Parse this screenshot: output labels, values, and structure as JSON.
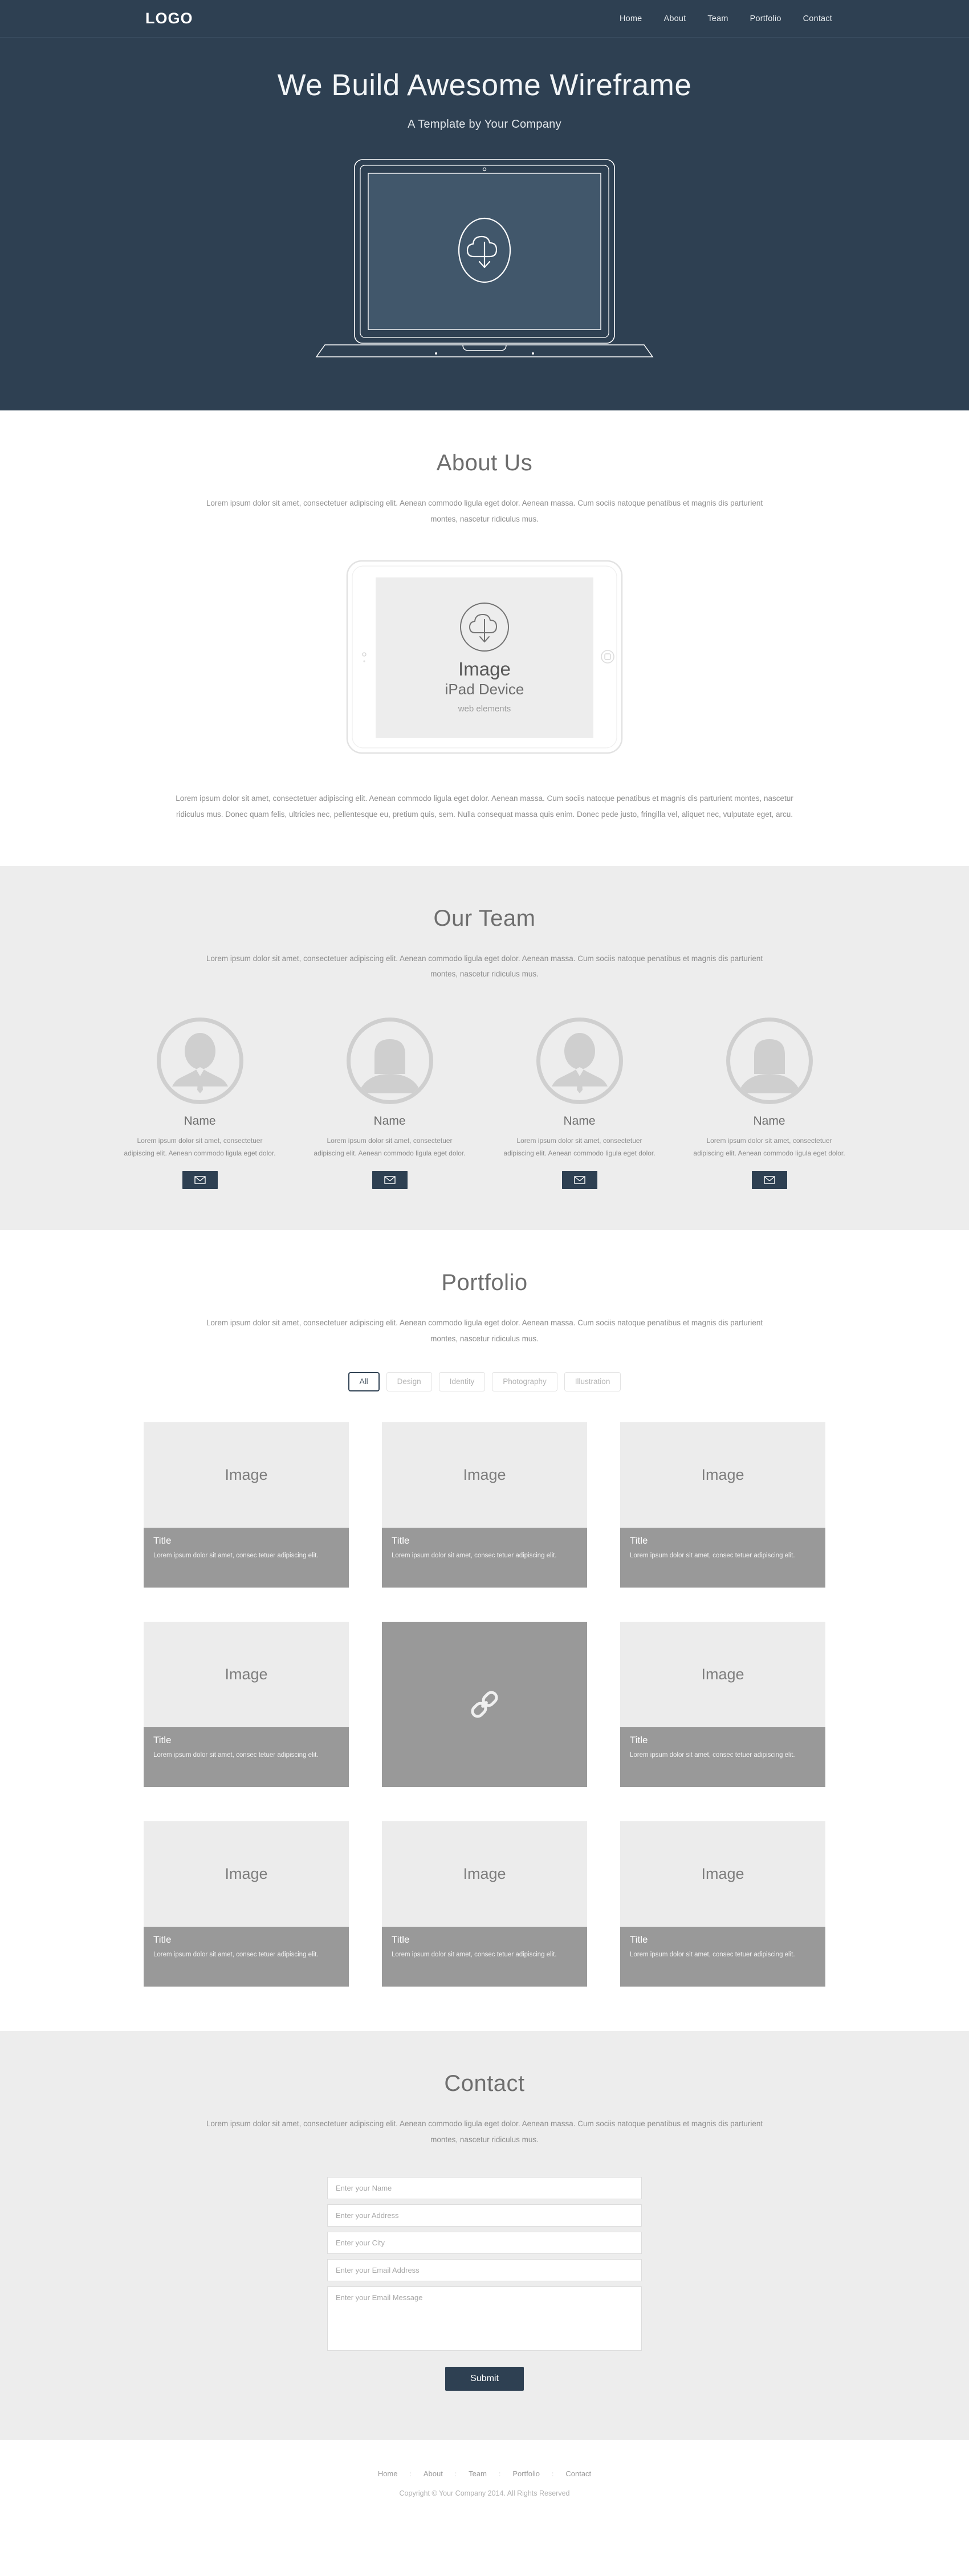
{
  "header": {
    "logo": "LOGO",
    "nav": [
      "Home",
      "About",
      "Team",
      "Portfolio",
      "Contact"
    ]
  },
  "hero": {
    "title": "We Build Awesome Wireframe",
    "subtitle": "A Template by Your Company",
    "device_icon": "cloud-download-icon"
  },
  "about": {
    "title": "About Us",
    "subtitle": "Lorem ipsum dolor sit amet, consectetuer adipiscing elit. Aenean commodo ligula eget dolor. Aenean massa. Cum sociis natoque penatibus et magnis dis parturient montes, nascetur ridiculus mus.",
    "device": {
      "image_label": "Image",
      "device_label": "iPad  Device",
      "caption": "web elements",
      "icon": "cloud-download-icon"
    },
    "body": "Lorem ipsum dolor sit amet, consectetuer adipiscing elit. Aenean commodo ligula eget dolor. Aenean massa. Cum sociis natoque penatibus et magnis dis parturient montes, nascetur ridiculus mus. Donec quam felis, ultricies nec, pellentesque eu, pretium quis, sem. Nulla consequat massa quis enim. Donec pede justo, fringilla vel, aliquet nec, vulputate eget, arcu."
  },
  "team": {
    "title": "Our Team",
    "subtitle": "Lorem ipsum dolor sit amet, consectetuer adipiscing elit. Aenean commodo ligula eget dolor. Aenean massa. Cum sociis natoque penatibus et magnis dis parturient montes, nascetur ridiculus mus.",
    "members": [
      {
        "name": "Name",
        "text": "Lorem ipsum dolor sit amet, consectetuer adipiscing elit. Aenean commodo ligula eget dolor.",
        "avatar": "avatar-male",
        "button_icon": "envelope-icon"
      },
      {
        "name": "Name",
        "text": "Lorem ipsum dolor sit amet, consectetuer adipiscing elit. Aenean commodo ligula eget dolor.",
        "avatar": "avatar-plain",
        "button_icon": "envelope-icon"
      },
      {
        "name": "Name",
        "text": "Lorem ipsum dolor sit amet, consectetuer adipiscing elit. Aenean commodo ligula eget dolor.",
        "avatar": "avatar-male",
        "button_icon": "envelope-icon"
      },
      {
        "name": "Name",
        "text": "Lorem ipsum dolor sit amet, consectetuer adipiscing elit. Aenean commodo ligula eget dolor.",
        "avatar": "avatar-plain",
        "button_icon": "envelope-icon"
      }
    ]
  },
  "portfolio": {
    "title": "Portfolio",
    "subtitle": "Lorem ipsum dolor sit amet, consectetuer adipiscing elit. Aenean commodo ligula eget dolor. Aenean massa. Cum sociis natoque penatibus et magnis dis parturient montes, nascetur ridiculus mus.",
    "filters": [
      {
        "label": "All",
        "active": true
      },
      {
        "label": "Design",
        "active": false
      },
      {
        "label": "Identity",
        "active": false
      },
      {
        "label": "Photography",
        "active": false
      },
      {
        "label": "Illustration",
        "active": false
      }
    ],
    "items": [
      {
        "image_label": "Image",
        "title": "Title",
        "desc": "Lorem ipsum dolor sit amet, consec tetuer adipiscing elit.",
        "state": "normal"
      },
      {
        "image_label": "Image",
        "title": "Title",
        "desc": "Lorem ipsum dolor sit amet, consec tetuer adipiscing elit.",
        "state": "normal"
      },
      {
        "image_label": "Image",
        "title": "Title",
        "desc": "Lorem ipsum dolor sit amet, consec tetuer adipiscing elit.",
        "state": "normal"
      },
      {
        "image_label": "Image",
        "title": "Title",
        "desc": "Lorem ipsum dolor sit amet, consec tetuer adipiscing elit.",
        "state": "normal"
      },
      {
        "image_label": "",
        "title": "",
        "desc": "",
        "state": "hovered",
        "icon": "chain-link-icon"
      },
      {
        "image_label": "Image",
        "title": "Title",
        "desc": "Lorem ipsum dolor sit amet, consec tetuer adipiscing elit.",
        "state": "normal"
      },
      {
        "image_label": "Image",
        "title": "Title",
        "desc": "Lorem ipsum dolor sit amet, consec tetuer adipiscing elit.",
        "state": "normal"
      },
      {
        "image_label": "Image",
        "title": "Title",
        "desc": "Lorem ipsum dolor sit amet, consec tetuer adipiscing elit.",
        "state": "normal"
      },
      {
        "image_label": "Image",
        "title": "Title",
        "desc": "Lorem ipsum dolor sit amet, consec tetuer adipiscing elit.",
        "state": "normal"
      }
    ]
  },
  "contact": {
    "title": "Contact",
    "subtitle": "Lorem ipsum dolor sit amet, consectetuer adipiscing elit. Aenean commodo ligula eget dolor. Aenean massa. Cum sociis natoque penatibus et magnis dis parturient montes, nascetur ridiculus mus.",
    "fields": {
      "name": {
        "placeholder": "Enter your Name",
        "value": ""
      },
      "address": {
        "placeholder": "Enter your Address",
        "value": ""
      },
      "city": {
        "placeholder": "Enter your City",
        "value": ""
      },
      "email": {
        "placeholder": "Enter your Email Address",
        "value": ""
      },
      "message": {
        "placeholder": "Enter your Email Message",
        "value": ""
      }
    },
    "submit_label": "Submit"
  },
  "footer": {
    "nav": [
      "Home",
      "About",
      "Team",
      "Portfolio",
      "Contact"
    ],
    "separator": ":",
    "copyright": "Copyright © Your Company 2014. All Rights Reserved"
  },
  "colors": {
    "navy": "#2e4052",
    "section_gray": "#ededed",
    "caption_gray": "#999999",
    "image_placeholder": "#ececec"
  }
}
